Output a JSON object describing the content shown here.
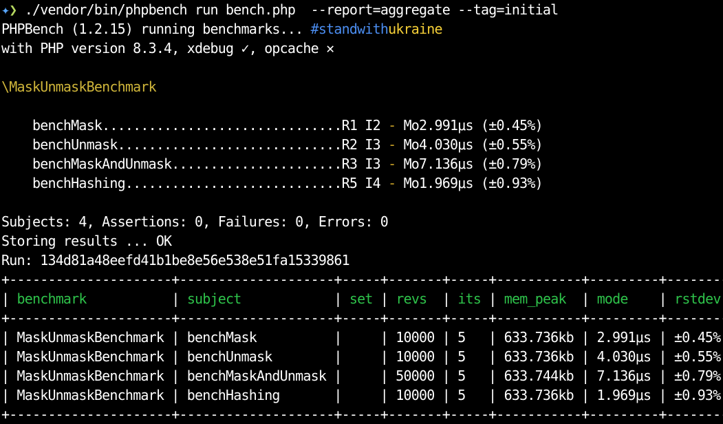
{
  "colors": {
    "background": "#000000",
    "text": "#ffffff",
    "prompt_icon": "#58a6ff",
    "prompt_chevron": "#b6d860",
    "hashtag_blue": "#4b8df0",
    "hashtag_yellow": "#f5cf37",
    "benchmark_title": "#cfb53a",
    "separator_dash": "#c9a227",
    "table_header": "#2ec24a"
  },
  "prompt": {
    "icon": "sparkle-icon",
    "icon_glyph": "✦",
    "chevron": "❯",
    "command": " ./vendor/bin/phpbench run bench.php  --report=aggregate --tag=initial"
  },
  "header": {
    "running_text": "PHPBench (1.2.15) running benchmarks... ",
    "hashtag_part1": "#standwith",
    "hashtag_part2": "ukraine",
    "php_version": "with PHP version 8.3.4, xdebug ✓, opcache ✕"
  },
  "benchmark_class": "\\MaskUnmaskBenchmark",
  "subjects": [
    {
      "dots_line": "    benchMask...............................",
      "rev_iter": "R1 I2",
      "sep": " - ",
      "result": "Mo2.991μs (±0.45%)"
    },
    {
      "dots_line": "    benchUnmask.............................",
      "rev_iter": "R2 I3",
      "sep": " - ",
      "result": "Mo4.030μs (±0.55%)"
    },
    {
      "dots_line": "    benchMaskAndUnmask......................",
      "rev_iter": "R3 I3",
      "sep": " - ",
      "result": "Mo7.136μs (±0.79%)"
    },
    {
      "dots_line": "    benchHashing............................",
      "rev_iter": "R5 I4",
      "sep": " - ",
      "result": "Mo1.969μs (±0.93%)"
    }
  ],
  "summary": {
    "counts": "Subjects: 4, Assertions: 0, Failures: 0, Errors: 0",
    "storing": "Storing results ... OK",
    "run": "Run: 134d81a48eefd41b1be8e56e538e51fa15339861"
  },
  "table": {
    "border": "+---------------------+--------------------+-----+-------+-----+-----------+---------+--------+",
    "header_pipes": [
      "| ",
      " | ",
      " | ",
      " | ",
      " | ",
      " | ",
      " | ",
      " | ",
      " |"
    ],
    "headers": [
      "benchmark          ",
      "subject           ",
      "set",
      "revs ",
      "its",
      "mem_peak ",
      "mode   ",
      "rstdev"
    ],
    "rows": [
      [
        "| MaskUnmaskBenchmark | benchMask          |     | 10000 | 5   | 633.736kb | 2.991μs | ±0.45% |"
      ],
      [
        "| MaskUnmaskBenchmark | benchUnmask        |     | 10000 | 5   | 633.736kb | 4.030μs | ±0.55% |"
      ],
      [
        "| MaskUnmaskBenchmark | benchMaskAndUnmask |     | 50000 | 5   | 633.744kb | 7.136μs | ±0.79% |"
      ],
      [
        "| MaskUnmaskBenchmark | benchHashing       |     | 10000 | 5   | 633.736kb | 1.969μs | ±0.93% |"
      ]
    ]
  }
}
